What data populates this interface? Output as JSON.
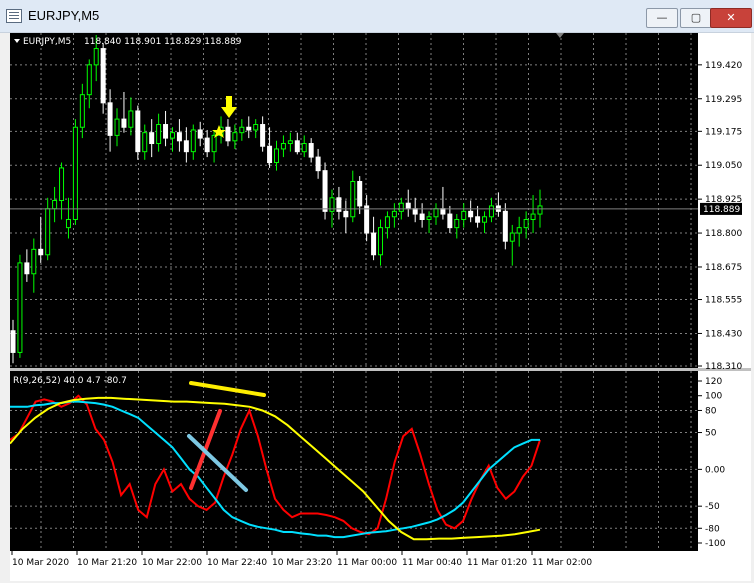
{
  "window": {
    "title": "EURJPY,M5",
    "minimize_label": "—",
    "maximize_label": "▢",
    "close_label": "✕"
  },
  "main_chart": {
    "header_symbol": "EURJPY,M5",
    "header_ohlc": "118.840 118.901 118.829 118.889",
    "current_price": "118.889",
    "price_ticks": [
      "119.420",
      "119.295",
      "119.175",
      "119.050",
      "118.925",
      "118.800",
      "118.675",
      "118.555",
      "118.430",
      "118.310"
    ],
    "colors": {
      "up": "#00ff00",
      "down": "#ffffff",
      "grid": "#7f7f7f",
      "background": "#000000"
    },
    "markers": {
      "star": "star-icon",
      "arrow": "down-arrow-icon",
      "marker_color": "#ffff00"
    }
  },
  "indicator": {
    "header": "R(9,26,52) 40.0 4.7 -80.7",
    "y_ticks": [
      "120",
      "100",
      "80",
      "50",
      "0.00",
      "-50",
      "-80",
      "-100"
    ],
    "line_colors": {
      "fast": "#ff0000",
      "medium": "#00e0ff",
      "slow": "#ffff00"
    },
    "annotation_colors": {
      "red": "#ff3030",
      "blue": "#7ec8e3",
      "yellow": "#ffee00"
    }
  },
  "time_axis": {
    "labels": [
      "10 Mar 2020",
      "10 Mar 21:20",
      "10 Mar 22:00",
      "10 Mar 22:40",
      "10 Mar 23:20",
      "11 Mar 00:00",
      "11 Mar 00:40",
      "11 Mar 01:20",
      "11 Mar 02:00"
    ]
  },
  "chart_data": {
    "type": "candlestick",
    "title": "EURJPY,M5",
    "ylim": [
      118.31,
      119.53
    ],
    "candles": [
      [
        118.44,
        118.48,
        118.32,
        118.36
      ],
      [
        118.36,
        118.72,
        118.34,
        118.69
      ],
      [
        118.69,
        118.74,
        118.62,
        118.65
      ],
      [
        118.65,
        118.78,
        118.58,
        118.74
      ],
      [
        118.74,
        118.86,
        118.69,
        118.72
      ],
      [
        118.72,
        118.93,
        118.7,
        118.89
      ],
      [
        118.89,
        118.97,
        118.84,
        118.92
      ],
      [
        118.92,
        119.06,
        118.85,
        119.04
      ],
      [
        118.82,
        118.93,
        118.78,
        118.85
      ],
      [
        118.85,
        119.22,
        118.83,
        119.19
      ],
      [
        119.19,
        119.35,
        119.15,
        119.31
      ],
      [
        119.31,
        119.44,
        119.26,
        119.42
      ],
      [
        119.42,
        119.53,
        119.36,
        119.48
      ],
      [
        119.48,
        119.5,
        119.24,
        119.28
      ],
      [
        119.28,
        119.33,
        119.1,
        119.16
      ],
      [
        119.16,
        119.26,
        119.12,
        119.22
      ],
      [
        119.22,
        119.32,
        119.17,
        119.19
      ],
      [
        119.19,
        119.3,
        119.16,
        119.25
      ],
      [
        119.25,
        119.27,
        119.07,
        119.1
      ],
      [
        119.1,
        119.2,
        119.07,
        119.17
      ],
      [
        119.17,
        119.22,
        119.08,
        119.13
      ],
      [
        119.13,
        119.24,
        119.1,
        119.2
      ],
      [
        119.2,
        119.25,
        119.12,
        119.15
      ],
      [
        119.15,
        119.19,
        119.1,
        119.17
      ],
      [
        119.17,
        119.22,
        119.1,
        119.14
      ],
      [
        119.14,
        119.19,
        119.06,
        119.1
      ],
      [
        119.1,
        119.2,
        119.07,
        119.18
      ],
      [
        119.18,
        119.21,
        119.12,
        119.15
      ],
      [
        119.15,
        119.18,
        119.08,
        119.1
      ],
      [
        119.1,
        119.18,
        119.06,
        119.16
      ],
      [
        119.16,
        119.23,
        119.13,
        119.19
      ],
      [
        119.19,
        119.22,
        119.12,
        119.14
      ],
      [
        119.14,
        119.2,
        119.11,
        119.17
      ],
      [
        119.17,
        119.22,
        119.14,
        119.19
      ],
      [
        119.19,
        119.23,
        119.15,
        119.18
      ],
      [
        119.18,
        119.22,
        119.15,
        119.2
      ],
      [
        119.2,
        119.23,
        119.1,
        119.12
      ],
      [
        119.12,
        119.19,
        119.04,
        119.06
      ],
      [
        119.06,
        119.14,
        119.03,
        119.11
      ],
      [
        119.11,
        119.16,
        119.08,
        119.13
      ],
      [
        119.13,
        119.17,
        119.1,
        119.14
      ],
      [
        119.14,
        119.17,
        119.09,
        119.1
      ],
      [
        119.1,
        119.16,
        119.08,
        119.13
      ],
      [
        119.13,
        119.15,
        119.06,
        119.08
      ],
      [
        119.08,
        119.11,
        119.0,
        119.03
      ],
      [
        119.03,
        119.06,
        118.85,
        118.88
      ],
      [
        118.88,
        118.96,
        118.82,
        118.93
      ],
      [
        118.93,
        118.97,
        118.85,
        118.88
      ],
      [
        118.88,
        118.92,
        118.8,
        118.86
      ],
      [
        118.86,
        119.03,
        118.84,
        118.99
      ],
      [
        118.99,
        119.01,
        118.87,
        118.9
      ],
      [
        118.9,
        118.94,
        118.77,
        118.8
      ],
      [
        118.8,
        118.86,
        118.7,
        118.72
      ],
      [
        118.72,
        118.85,
        118.68,
        118.82
      ],
      [
        118.82,
        118.88,
        118.78,
        118.86
      ],
      [
        118.86,
        118.91,
        118.82,
        118.88
      ],
      [
        118.88,
        118.93,
        118.85,
        118.91
      ],
      [
        118.91,
        118.96,
        118.86,
        118.89
      ],
      [
        118.89,
        118.93,
        118.84,
        118.87
      ],
      [
        118.87,
        118.91,
        118.82,
        118.85
      ],
      [
        118.85,
        118.88,
        118.8,
        118.86
      ],
      [
        118.86,
        118.91,
        118.83,
        118.89
      ],
      [
        118.89,
        118.97,
        118.85,
        118.87
      ],
      [
        118.87,
        118.9,
        118.8,
        118.82
      ],
      [
        118.82,
        118.87,
        118.78,
        118.85
      ],
      [
        118.85,
        118.91,
        118.82,
        118.88
      ],
      [
        118.88,
        118.92,
        118.84,
        118.86
      ],
      [
        118.86,
        118.9,
        118.82,
        118.84
      ],
      [
        118.84,
        118.88,
        118.8,
        118.86
      ],
      [
        118.86,
        118.93,
        118.84,
        118.9
      ],
      [
        118.9,
        118.95,
        118.86,
        118.88
      ],
      [
        118.88,
        118.91,
        118.74,
        118.77
      ],
      [
        118.77,
        118.83,
        118.68,
        118.8
      ],
      [
        118.8,
        118.86,
        118.75,
        118.82
      ],
      [
        118.82,
        118.88,
        118.78,
        118.85
      ],
      [
        118.85,
        118.94,
        118.8,
        118.87
      ],
      [
        118.87,
        118.96,
        118.82,
        118.9
      ]
    ],
    "indicator_series": [
      {
        "name": "fast",
        "values": [
          40,
          48,
          70,
          92,
          95,
          92,
          85,
          90,
          100,
          88,
          55,
          40,
          10,
          -35,
          -20,
          -55,
          -65,
          -20,
          0,
          -30,
          -20,
          -40,
          -50,
          -55,
          -45,
          -10,
          20,
          55,
          80,
          45,
          0,
          -40,
          -55,
          -65,
          -60,
          -60,
          -60,
          -62,
          -65,
          -70,
          -80,
          -85,
          -88,
          -80,
          -40,
          10,
          45,
          55,
          20,
          -20,
          -55,
          -75,
          -80,
          -70,
          -40,
          -15,
          5,
          -25,
          -40,
          -30,
          -10,
          5,
          40
        ]
      },
      {
        "name": "medium",
        "values": [
          85,
          85,
          85,
          87,
          88,
          90,
          90,
          92,
          92,
          91,
          90,
          88,
          85,
          80,
          75,
          70,
          60,
          50,
          40,
          30,
          15,
          0,
          -10,
          -25,
          -40,
          -55,
          -65,
          -70,
          -75,
          -78,
          -80,
          -82,
          -85,
          -85,
          -87,
          -88,
          -90,
          -90,
          -92,
          -92,
          -90,
          -88,
          -86,
          -85,
          -84,
          -82,
          -80,
          -78,
          -75,
          -72,
          -68,
          -62,
          -55,
          -45,
          -30,
          -15,
          0,
          10,
          20,
          30,
          35,
          40,
          40
        ]
      },
      {
        "name": "slow",
        "values": [
          35,
          55,
          70,
          82,
          90,
          94,
          96,
          97,
          97,
          96,
          95,
          94,
          93,
          92,
          92,
          91,
          90,
          89,
          87,
          85,
          80,
          72,
          60,
          45,
          30,
          15,
          0,
          -15,
          -30,
          -50,
          -70,
          -85,
          -95,
          -95,
          -94,
          -94,
          -93,
          -92,
          -91,
          -90,
          -88,
          -85,
          -82
        ]
      }
    ]
  }
}
